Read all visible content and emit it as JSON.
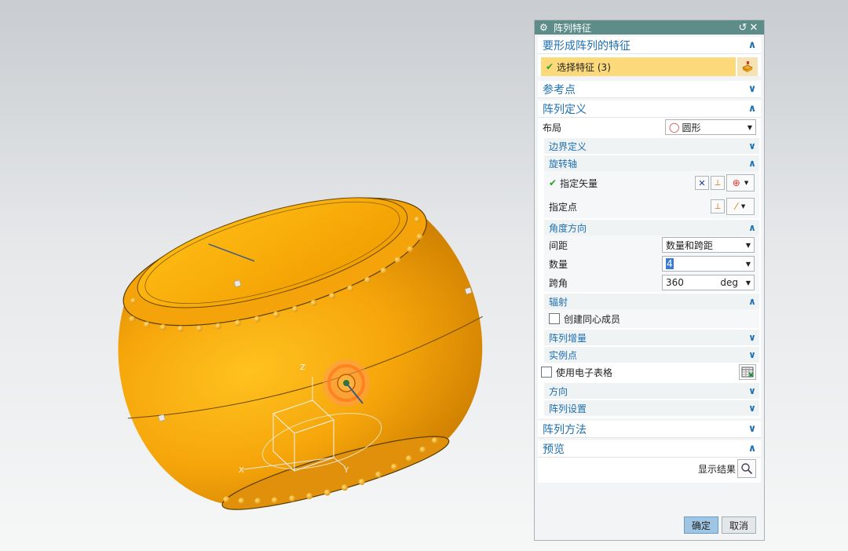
{
  "dialog": {
    "title": "阵列特征",
    "reset_icon": "↺",
    "close_icon": "✕",
    "section_feature": {
      "title": "要形成阵列的特征",
      "select_label": "选择特征 (3)"
    },
    "section_ref_point": {
      "title": "参考点"
    },
    "section_definition": {
      "title": "阵列定义",
      "layout_label": "布局",
      "layout_value": "圆形",
      "boundary": "边界定义",
      "rotation_axis": {
        "title": "旋转轴",
        "vector_label": "指定矢量",
        "point_label": "指定点"
      },
      "angle_direction": {
        "title": "角度方向",
        "spacing_label": "间距",
        "spacing_value": "数量和跨距",
        "count_label": "数量",
        "count_value": "4",
        "span_label": "跨角",
        "span_value": "360",
        "span_unit": "deg"
      },
      "radiation": {
        "title": "辐射",
        "concentric_label": "创建同心成员",
        "concentric_checked": false
      },
      "increment": "阵列增量",
      "instance_points": "实例点",
      "spreadsheet_label": "使用电子表格",
      "spreadsheet_checked": false,
      "orientation": "方向",
      "settings": "阵列设置"
    },
    "section_method": {
      "title": "阵列方法"
    },
    "section_preview": {
      "title": "预览",
      "show_result": "显示结果"
    },
    "ok_label": "确定",
    "cancel_label": "取消"
  },
  "viewport": {
    "axis_x": "X",
    "axis_y": "Y",
    "axis_z": "Z",
    "model_color": "#f5a50a"
  },
  "colors": {
    "title_bar": "#5e8c88",
    "section_blue": "#1e6fb0",
    "selection_highlight": "#fcd97a",
    "ok_button": "#9ec6e4"
  }
}
